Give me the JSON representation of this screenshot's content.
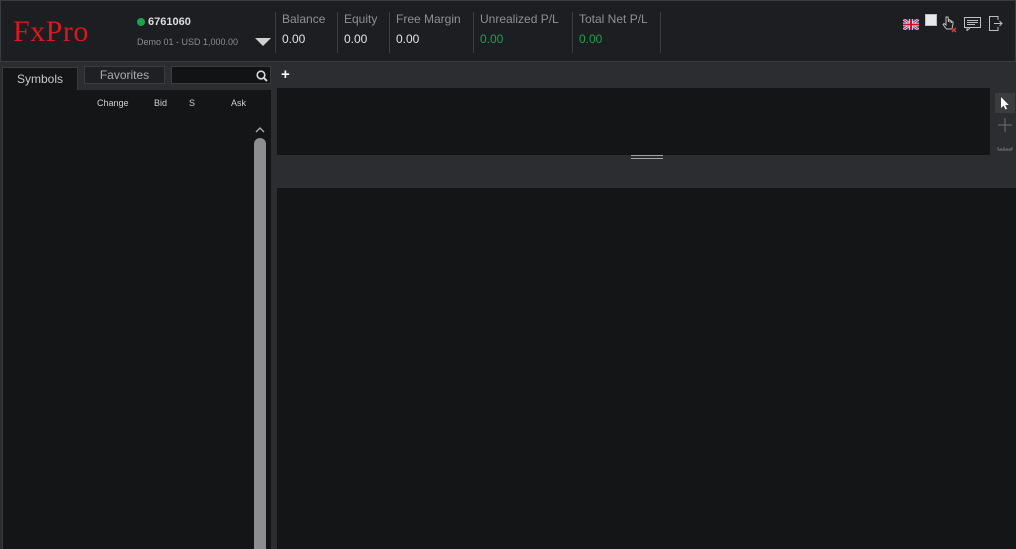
{
  "brand": {
    "logo_text": "FxPro",
    "logo_color": "#d71920"
  },
  "account": {
    "number": "6761060",
    "status_color": "#1aa34a",
    "description": "Demo 01 - USD 1,000.00"
  },
  "metrics": {
    "balance": {
      "label": "Balance",
      "value": "0.00"
    },
    "equity": {
      "label": "Equity",
      "value": "0.00"
    },
    "free_margin": {
      "label": "Free Margin",
      "value": "0.00"
    },
    "unrealized_pl": {
      "label": "Unrealized P/L",
      "value": "0.00"
    },
    "total_net_pl": {
      "label": "Total Net P/L",
      "value": "0.00"
    }
  },
  "header_icons": [
    "uk-flag-icon",
    "window-icon",
    "hand-cursor-icon",
    "message-icon",
    "logout-icon"
  ],
  "left_panel": {
    "tabs": {
      "symbols": "Symbols",
      "favorites": "Favorites"
    },
    "search": {
      "value": "",
      "placeholder": ""
    },
    "columns": {
      "change": "Change",
      "bid": "Bid",
      "spread": "S",
      "ask": "Ask"
    }
  },
  "chart": {
    "add_tab_label": "+",
    "tools": [
      "pointer-icon",
      "crosshair-icon",
      "ruler-icon"
    ]
  }
}
